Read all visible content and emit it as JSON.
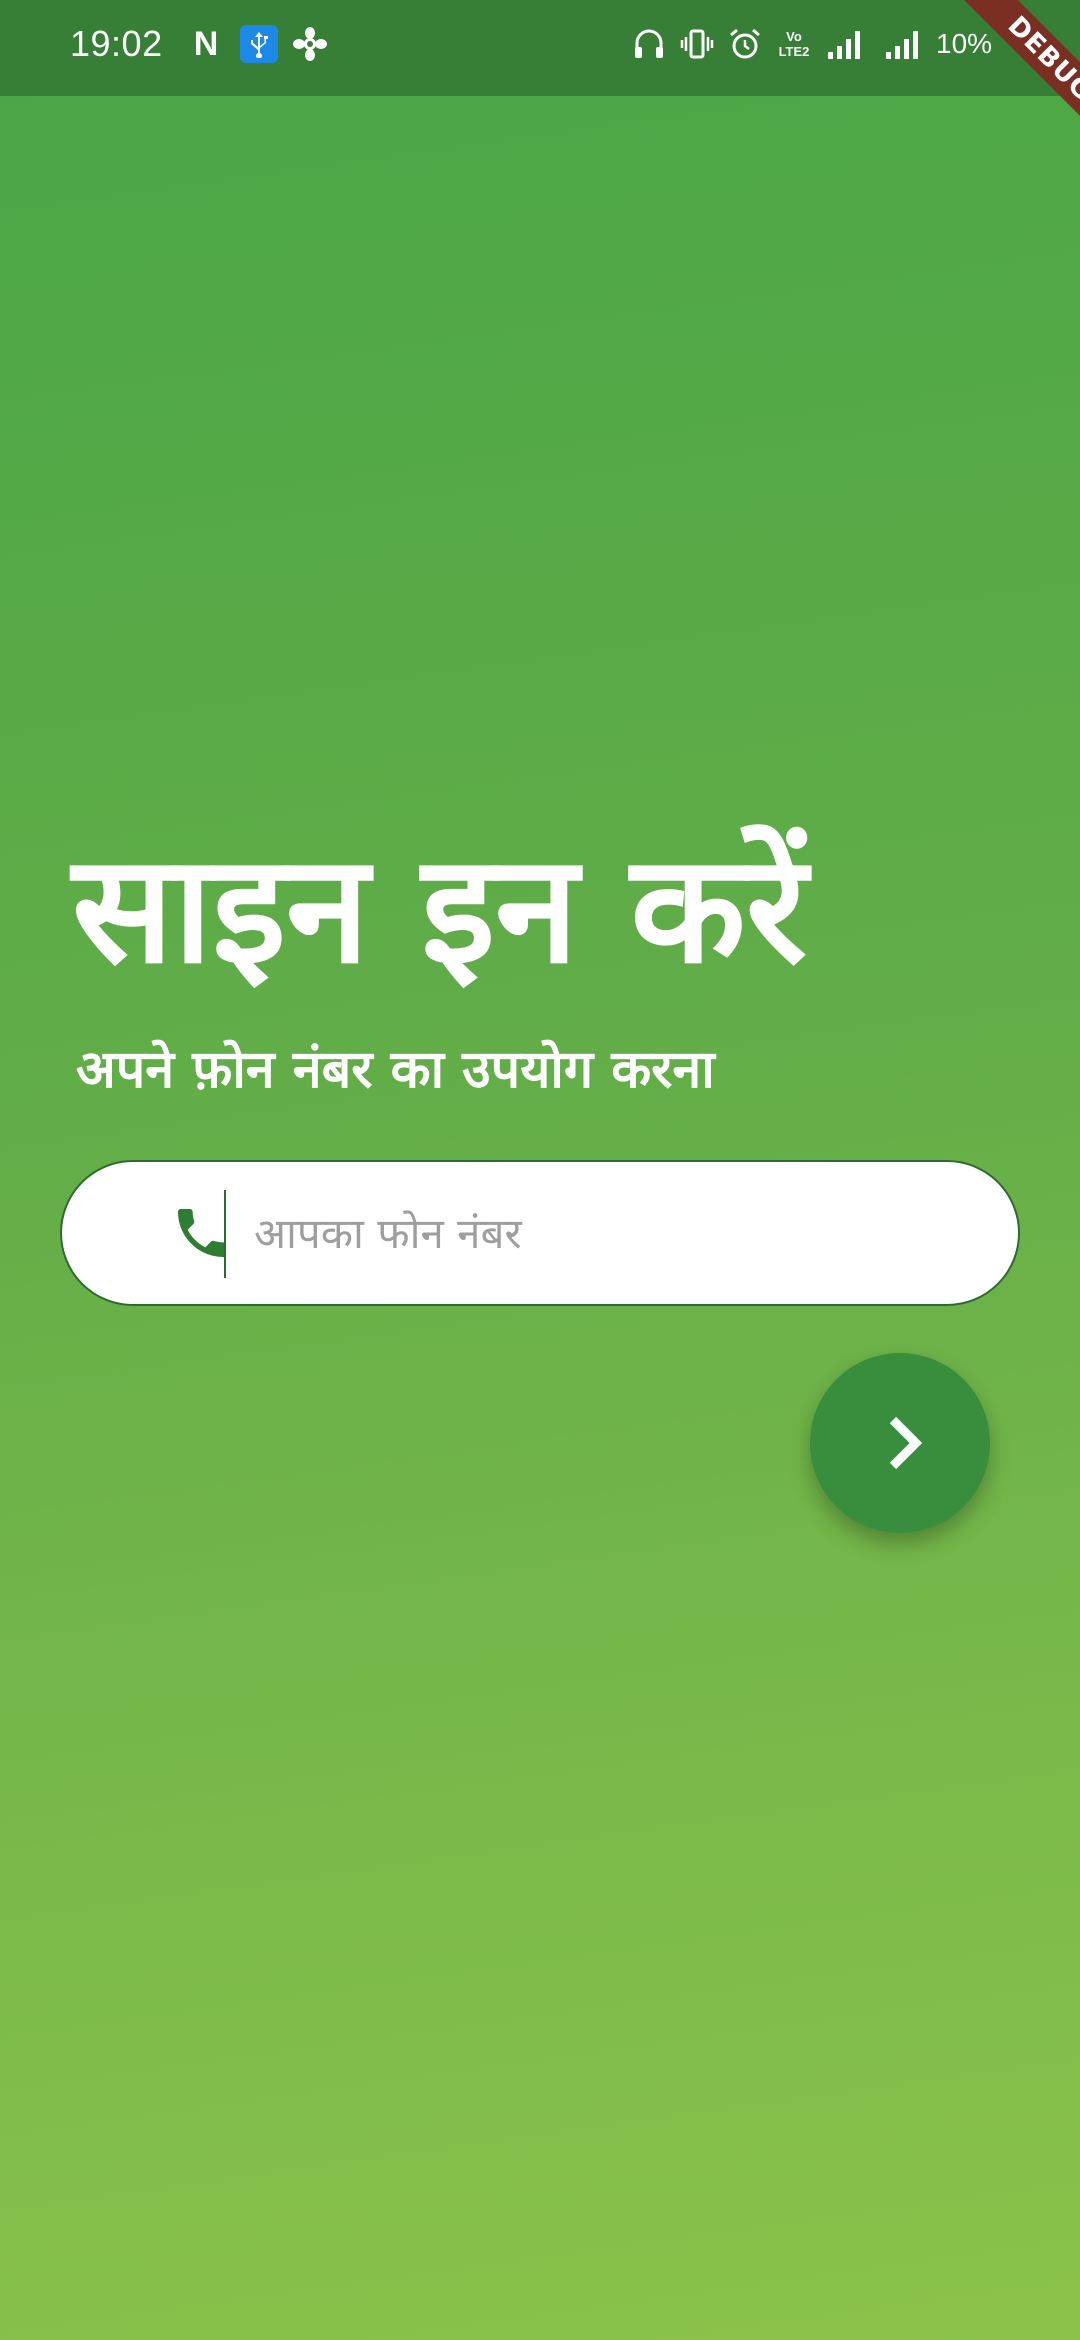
{
  "status_bar": {
    "time": "19:02",
    "netflix_glyph": "N",
    "volte_top": "Vo",
    "volte_bottom": "LTE2",
    "battery": "10%",
    "icons": [
      "netflix-icon",
      "usb-icon",
      "flower-icon",
      "headset-icon",
      "vibrate-icon",
      "alarm-icon",
      "volte-icon",
      "signal-icon",
      "signal-icon"
    ]
  },
  "debug_banner": "DEBUG",
  "title": "साइन इन करें",
  "subtitle": "अपने फ़ोन नंबर का उपयोग करना",
  "phone_field": {
    "icon": "phone-icon",
    "placeholder": "आपका फोन नंबर",
    "value": ""
  },
  "next_button": {
    "icon": "chevron-right-icon"
  },
  "colors": {
    "status_bar": "#377e36",
    "gradient_top": "#49a646",
    "gradient_bottom": "#8bc34a",
    "accent": "#2e7d32",
    "fab": "#388e3c",
    "debug_banner": "#7b2f22",
    "text": "#ffffff"
  }
}
